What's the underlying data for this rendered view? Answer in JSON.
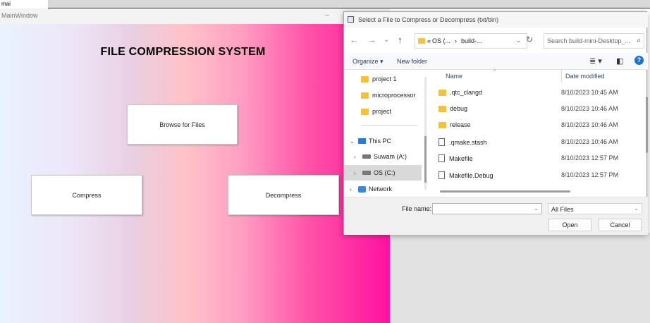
{
  "top_tab": "mai",
  "main_window": {
    "title": "MainWindow",
    "app_title": "FILE COMPRESSION SYSTEM",
    "browse_label": "Browse for Files",
    "compress_label": "Compress",
    "decompress_label": "Decompress"
  },
  "dialog": {
    "title": "Select a File to Compress or Decompress (txt/bin)",
    "address": {
      "separator": "«",
      "segment_1": "OS (...",
      "arrow": "›",
      "segment_2": "build-..."
    },
    "search_placeholder": "Search build-mini-Desktop_...",
    "toolbar": {
      "organize": "Organize",
      "new_folder": "New folder"
    },
    "nav": {
      "items": [
        {
          "label": "project 1"
        },
        {
          "label": "microprocessor"
        },
        {
          "label": "project"
        }
      ],
      "this_pc": "This PC",
      "drive_a": "Suwam (A:)",
      "drive_c": "OS (C:)",
      "network": "Network"
    },
    "columns": {
      "name": "Name",
      "date_modified": "Date modified"
    },
    "files": [
      {
        "name": ".qtc_clangd",
        "date": "8/10/2023 10:45 AM",
        "icon": "folder-icon"
      },
      {
        "name": "debug",
        "date": "8/10/2023 10:46 AM",
        "icon": "folder-icon"
      },
      {
        "name": "release",
        "date": "8/10/2023 10:46 AM",
        "icon": "folder-icon"
      },
      {
        "name": ".qmake.stash",
        "date": "8/10/2023 10:46 AM",
        "icon": "file-icon"
      },
      {
        "name": "Makefile",
        "date": "8/10/2023 12:57 PM",
        "icon": "file-icon"
      },
      {
        "name": "Makefile.Debug",
        "date": "8/10/2023 12:57 PM",
        "icon": "file-icon"
      }
    ],
    "file_name_label": "File name:",
    "file_name_value": "",
    "file_type": "All Files",
    "open_label": "Open",
    "cancel_label": "Cancel"
  }
}
